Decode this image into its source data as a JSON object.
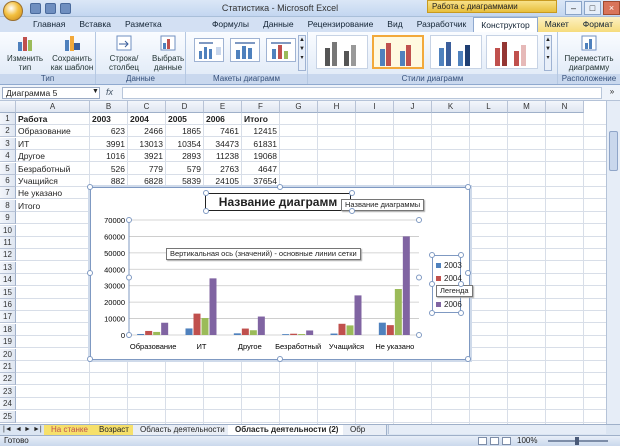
{
  "app": {
    "title": "Статистика - Microsoft Excel",
    "context_tab_title": "Работа с диаграммами"
  },
  "tabs": [
    {
      "label": "Главная"
    },
    {
      "label": "Вставка"
    },
    {
      "label": "Разметка страницы"
    },
    {
      "label": "Формулы"
    },
    {
      "label": "Данные"
    },
    {
      "label": "Рецензирование"
    },
    {
      "label": "Вид"
    },
    {
      "label": "Разработчик"
    },
    {
      "label": "Конструктор"
    },
    {
      "label": "Макет"
    },
    {
      "label": "Формат"
    }
  ],
  "ribbon": {
    "type_group": {
      "label": "Тип",
      "change_type": "Изменить тип диаграммы",
      "save_template": "Сохранить как шаблон"
    },
    "data_group": {
      "label": "Данные",
      "row_col": "Строка/столбец",
      "select_data": "Выбрать данные"
    },
    "layouts_group": {
      "label": "Макеты диаграмм"
    },
    "styles_group": {
      "label": "Стили диаграмм"
    },
    "location_group": {
      "label": "Расположение",
      "move_chart": "Переместить диаграмму"
    }
  },
  "formula_bar": {
    "name_box": "Диаграмма 5",
    "fx": "fx",
    "value": ""
  },
  "columns": [
    "A",
    "B",
    "C",
    "D",
    "E",
    "F",
    "G",
    "H",
    "I",
    "J",
    "K",
    "L",
    "M",
    "N"
  ],
  "rows": [
    "1",
    "2",
    "3",
    "4",
    "5",
    "6",
    "7",
    "8",
    "9",
    "10",
    "11",
    "12",
    "13",
    "14",
    "15",
    "16",
    "17",
    "18",
    "19",
    "20",
    "21",
    "22",
    "23",
    "24",
    "25"
  ],
  "table": {
    "headers": [
      "Работа",
      "2003",
      "2004",
      "2005",
      "2006",
      "Итого"
    ],
    "rows": [
      [
        "Образование",
        "623",
        "2466",
        "1865",
        "7461",
        "12415"
      ],
      [
        "ИТ",
        "3991",
        "13013",
        "10354",
        "34473",
        "61831"
      ],
      [
        "Другое",
        "1016",
        "3921",
        "2893",
        "11238",
        "19068"
      ],
      [
        "Безработный",
        "526",
        "779",
        "579",
        "2763",
        "4647"
      ],
      [
        "Учащийся",
        "882",
        "6828",
        "5839",
        "24105",
        "37654"
      ],
      [
        "Не указано",
        "",
        "",
        "",
        "",
        ""
      ],
      [
        "Итого",
        "",
        "",
        "",
        "",
        ""
      ]
    ]
  },
  "chart_data": {
    "type": "bar",
    "title": "Название диаграмм",
    "categories": [
      "Образование",
      "ИТ",
      "Другое",
      "Безработный",
      "Учащийся",
      "Не указано"
    ],
    "series": [
      {
        "name": "2003",
        "color": "#4f81bd",
        "values": [
          623,
          3991,
          1016,
          526,
          882,
          7500
        ]
      },
      {
        "name": "2004",
        "color": "#c0504d",
        "values": [
          2466,
          13013,
          3921,
          779,
          6828,
          6000
        ]
      },
      {
        "name": "2005",
        "color": "#9bbb59",
        "values": [
          1865,
          10354,
          2893,
          579,
          5839,
          28000
        ]
      },
      {
        "name": "2006",
        "color": "#8064a2",
        "values": [
          7461,
          34473,
          11238,
          2763,
          24105,
          60000
        ]
      }
    ],
    "yticks": [
      "0",
      "10000",
      "20000",
      "30000",
      "40000",
      "50000",
      "60000",
      "70000"
    ],
    "ylim": [
      0,
      70000
    ],
    "grid": true,
    "legend": "right",
    "tooltip_title": "Название диаграммы",
    "tooltip_axis": "Вертикальная ось (значений) - основные линии сетки",
    "tooltip_legend": "Легенда"
  },
  "sheet_tabs": {
    "tab1": "На станке",
    "tab2": "Возраст",
    "tab3": "Область деятельности",
    "tab4": "Область деятельности (2)",
    "tab5": "Обр"
  },
  "status": {
    "ready": "Готово",
    "zoom": "100%"
  }
}
